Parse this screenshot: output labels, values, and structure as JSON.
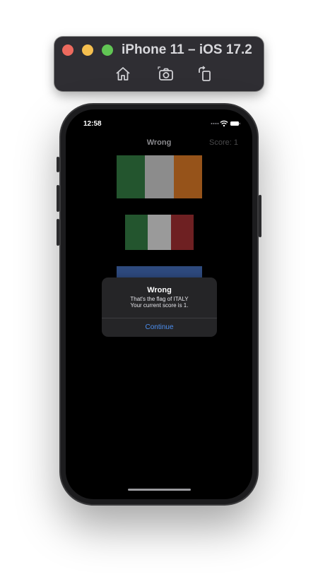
{
  "simulator": {
    "title": "iPhone 11 – iOS 17.2",
    "buttons": [
      "home-icon",
      "screenshot-icon",
      "rotate-icon"
    ]
  },
  "status_bar": {
    "time": "12:58"
  },
  "nav": {
    "title": "Wrong",
    "score": "Score: 1"
  },
  "flags": [
    {
      "name": "flag-ireland",
      "colors": [
        "#23552e",
        "#8c8c8c",
        "#96531a"
      ]
    },
    {
      "name": "flag-italy",
      "colors": [
        "#23552e",
        "#9a9a9a",
        "#6e2022"
      ]
    },
    {
      "name": "flag-partial",
      "colors": [
        "#2e4a7e"
      ]
    }
  ],
  "alert": {
    "title": "Wrong",
    "message_line1": "That's the flag of ITALY",
    "message_line2": "Your current score is 1.",
    "button_label": "Continue"
  },
  "colors": {
    "accent": "#4c8ff0",
    "screen_background": "#000000",
    "alert_background": "#252527"
  }
}
